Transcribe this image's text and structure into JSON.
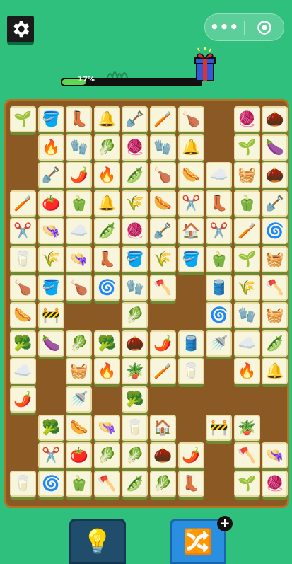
{
  "header": {
    "settings_icon": "gear-icon",
    "menu_dots": "•••",
    "close_icon": "target-icon"
  },
  "progress": {
    "percent_label": "17%",
    "value": 0.17,
    "reward_icon": "gift-icon"
  },
  "board": {
    "tiles": [
      {
        "r": 0,
        "c": 0,
        "i": "🌱"
      },
      {
        "r": 0,
        "c": 1,
        "i": "🪣"
      },
      {
        "r": 0,
        "c": 2,
        "i": "👢"
      },
      {
        "r": 0,
        "c": 3,
        "i": "🔔"
      },
      {
        "r": 0,
        "c": 4,
        "i": "🪏"
      },
      {
        "r": 0,
        "c": 5,
        "i": "🪥"
      },
      {
        "r": 0,
        "c": 6,
        "i": "🍗"
      },
      {
        "r": 0,
        "c": 8,
        "i": "🧶"
      },
      {
        "r": 0,
        "c": 9,
        "i": "🌰"
      },
      {
        "r": 1,
        "c": 1,
        "i": "🔥"
      },
      {
        "r": 1,
        "c": 2,
        "i": "🧤"
      },
      {
        "r": 1,
        "c": 3,
        "i": "🥬"
      },
      {
        "r": 1,
        "c": 4,
        "i": "🧶"
      },
      {
        "r": 1,
        "c": 5,
        "i": "🧤"
      },
      {
        "r": 1,
        "c": 6,
        "i": "🔔"
      },
      {
        "r": 1,
        "c": 8,
        "i": "🌱"
      },
      {
        "r": 1,
        "c": 9,
        "i": "🍆"
      },
      {
        "r": 2,
        "c": 1,
        "i": "🪏"
      },
      {
        "r": 2,
        "c": 2,
        "i": "🌶️"
      },
      {
        "r": 2,
        "c": 3,
        "i": "🔥"
      },
      {
        "r": 2,
        "c": 4,
        "i": "🫛"
      },
      {
        "r": 2,
        "c": 5,
        "i": "🍗"
      },
      {
        "r": 2,
        "c": 6,
        "i": "🌭"
      },
      {
        "r": 2,
        "c": 7,
        "i": "☁️"
      },
      {
        "r": 2,
        "c": 8,
        "i": "🧺"
      },
      {
        "r": 2,
        "c": 9,
        "i": "🌰"
      },
      {
        "r": 3,
        "c": 0,
        "i": "🪥"
      },
      {
        "r": 3,
        "c": 1,
        "i": "🍅"
      },
      {
        "r": 3,
        "c": 2,
        "i": "🫑"
      },
      {
        "r": 3,
        "c": 3,
        "i": "🔔"
      },
      {
        "r": 3,
        "c": 4,
        "i": "🌾"
      },
      {
        "r": 3,
        "c": 5,
        "i": "🌭"
      },
      {
        "r": 3,
        "c": 6,
        "i": "✂️"
      },
      {
        "r": 3,
        "c": 7,
        "i": "👢"
      },
      {
        "r": 3,
        "c": 8,
        "i": "🫑"
      },
      {
        "r": 3,
        "c": 9,
        "i": "🪏"
      },
      {
        "r": 4,
        "c": 0,
        "i": "✂️"
      },
      {
        "r": 4,
        "c": 1,
        "i": "👒"
      },
      {
        "r": 4,
        "c": 2,
        "i": "☁️"
      },
      {
        "r": 4,
        "c": 3,
        "i": "🫛"
      },
      {
        "r": 4,
        "c": 4,
        "i": "🧶"
      },
      {
        "r": 4,
        "c": 5,
        "i": "🪏"
      },
      {
        "r": 4,
        "c": 6,
        "i": "🏠"
      },
      {
        "r": 4,
        "c": 7,
        "i": "✂️"
      },
      {
        "r": 4,
        "c": 8,
        "i": "🪥"
      },
      {
        "r": 4,
        "c": 9,
        "i": "🌀"
      },
      {
        "r": 5,
        "c": 0,
        "i": "🥛"
      },
      {
        "r": 5,
        "c": 1,
        "i": "🌾"
      },
      {
        "r": 5,
        "c": 2,
        "i": "👒"
      },
      {
        "r": 5,
        "c": 3,
        "i": "👢"
      },
      {
        "r": 5,
        "c": 4,
        "i": "🪣"
      },
      {
        "r": 5,
        "c": 5,
        "i": "🌾"
      },
      {
        "r": 5,
        "c": 6,
        "i": "🪣"
      },
      {
        "r": 5,
        "c": 7,
        "i": "🫑"
      },
      {
        "r": 5,
        "c": 8,
        "i": "🌱"
      },
      {
        "r": 5,
        "c": 9,
        "i": "🧺"
      },
      {
        "r": 6,
        "c": 0,
        "i": "🍗"
      },
      {
        "r": 6,
        "c": 1,
        "i": "🪣"
      },
      {
        "r": 6,
        "c": 2,
        "i": "🍗"
      },
      {
        "r": 6,
        "c": 3,
        "i": "🌀"
      },
      {
        "r": 6,
        "c": 4,
        "i": "🧤"
      },
      {
        "r": 6,
        "c": 5,
        "i": "🪓"
      },
      {
        "r": 6,
        "c": 7,
        "i": "🛢️"
      },
      {
        "r": 6,
        "c": 8,
        "i": "🌾"
      },
      {
        "r": 6,
        "c": 9,
        "i": "🪓"
      },
      {
        "r": 7,
        "c": 0,
        "i": "🌭"
      },
      {
        "r": 7,
        "c": 1,
        "i": "🚧"
      },
      {
        "r": 7,
        "c": 4,
        "i": "🥬"
      },
      {
        "r": 7,
        "c": 7,
        "i": "🌀"
      },
      {
        "r": 7,
        "c": 8,
        "i": "🧤"
      },
      {
        "r": 7,
        "c": 9,
        "i": "🧺"
      },
      {
        "r": 8,
        "c": 0,
        "i": "🥦"
      },
      {
        "r": 8,
        "c": 1,
        "i": "🍆"
      },
      {
        "r": 8,
        "c": 2,
        "i": "🥬"
      },
      {
        "r": 8,
        "c": 3,
        "i": "🥦"
      },
      {
        "r": 8,
        "c": 4,
        "i": "🌰"
      },
      {
        "r": 8,
        "c": 5,
        "i": "🌶️"
      },
      {
        "r": 8,
        "c": 6,
        "i": "🛢️"
      },
      {
        "r": 8,
        "c": 7,
        "i": "🚿"
      },
      {
        "r": 8,
        "c": 8,
        "i": "☁️"
      },
      {
        "r": 8,
        "c": 9,
        "i": "🫛"
      },
      {
        "r": 9,
        "c": 0,
        "i": "☁️"
      },
      {
        "r": 9,
        "c": 2,
        "i": "🧺"
      },
      {
        "r": 9,
        "c": 3,
        "i": "🔥"
      },
      {
        "r": 9,
        "c": 4,
        "i": "🪴"
      },
      {
        "r": 9,
        "c": 5,
        "i": "🪥"
      },
      {
        "r": 9,
        "c": 6,
        "i": "🥛"
      },
      {
        "r": 9,
        "c": 8,
        "i": "🔥"
      },
      {
        "r": 9,
        "c": 9,
        "i": "🔔"
      },
      {
        "r": 10,
        "c": 0,
        "i": "🌶️"
      },
      {
        "r": 10,
        "c": 2,
        "i": "🚿"
      },
      {
        "r": 10,
        "c": 4,
        "i": "🥦"
      },
      {
        "r": 11,
        "c": 1,
        "i": "🥦"
      },
      {
        "r": 11,
        "c": 2,
        "i": "🌭"
      },
      {
        "r": 11,
        "c": 3,
        "i": "👒"
      },
      {
        "r": 11,
        "c": 4,
        "i": "🥛"
      },
      {
        "r": 11,
        "c": 5,
        "i": "🏠"
      },
      {
        "r": 11,
        "c": 7,
        "i": "🚧"
      },
      {
        "r": 11,
        "c": 8,
        "i": "🪴"
      },
      {
        "r": 12,
        "c": 1,
        "i": "✂️"
      },
      {
        "r": 12,
        "c": 2,
        "i": "🍅"
      },
      {
        "r": 12,
        "c": 3,
        "i": "🥬"
      },
      {
        "r": 12,
        "c": 4,
        "i": "🥬"
      },
      {
        "r": 12,
        "c": 5,
        "i": "🌰"
      },
      {
        "r": 12,
        "c": 6,
        "i": "🌶️"
      },
      {
        "r": 12,
        "c": 8,
        "i": "🪓"
      },
      {
        "r": 12,
        "c": 9,
        "i": "👒"
      },
      {
        "r": 13,
        "c": 0,
        "i": "🥛"
      },
      {
        "r": 13,
        "c": 1,
        "i": "🌀"
      },
      {
        "r": 13,
        "c": 2,
        "i": "🫑"
      },
      {
        "r": 13,
        "c": 3,
        "i": "🪓"
      },
      {
        "r": 13,
        "c": 4,
        "i": "🫛"
      },
      {
        "r": 13,
        "c": 5,
        "i": "🥬"
      },
      {
        "r": 13,
        "c": 6,
        "i": "👢"
      },
      {
        "r": 13,
        "c": 8,
        "i": "🌱"
      },
      {
        "r": 13,
        "c": 9,
        "i": "🧶"
      }
    ]
  },
  "buttons": {
    "hint_icon": "💡",
    "swap_icon": "🔀",
    "swap_plus": "+"
  }
}
